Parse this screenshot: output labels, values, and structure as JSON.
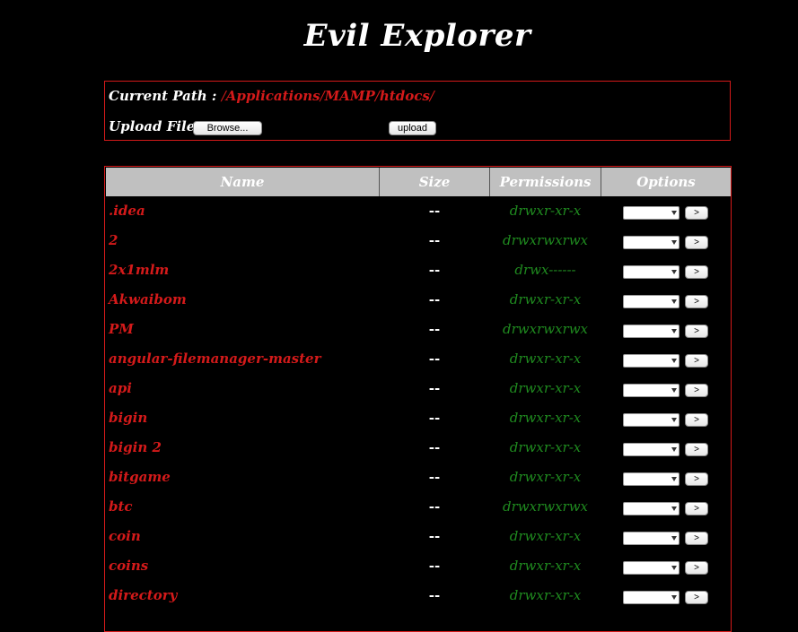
{
  "title": "Evil Explorer",
  "path": {
    "label": "Current Path :",
    "segments": [
      {
        "sep": "/",
        "name": "Applications"
      },
      {
        "sep": "/",
        "name": "MAMP"
      },
      {
        "sep": "/",
        "name": "htdocs"
      }
    ],
    "trailing_sep": "/"
  },
  "upload": {
    "label": "Upload File :",
    "browse_label": "Browse...",
    "upload_label": "upload"
  },
  "table": {
    "headers": {
      "name": "Name",
      "size": "Size",
      "permissions": "Permissions",
      "options": "Options"
    },
    "go_label": ">",
    "rows": [
      {
        "name": ".idea",
        "size": "--",
        "perm": "drwxr-xr-x"
      },
      {
        "name": "2",
        "size": "--",
        "perm": "drwxrwxrwx"
      },
      {
        "name": "2x1mlm",
        "size": "--",
        "perm": "drwx------"
      },
      {
        "name": "Akwaibom",
        "size": "--",
        "perm": "drwxr-xr-x"
      },
      {
        "name": "PM",
        "size": "--",
        "perm": "drwxrwxrwx"
      },
      {
        "name": "angular-filemanager-master",
        "size": "--",
        "perm": "drwxr-xr-x"
      },
      {
        "name": "api",
        "size": "--",
        "perm": "drwxr-xr-x"
      },
      {
        "name": "bigin",
        "size": "--",
        "perm": "drwxr-xr-x"
      },
      {
        "name": "bigin 2",
        "size": "--",
        "perm": "drwxr-xr-x"
      },
      {
        "name": "bitgame",
        "size": "--",
        "perm": "drwxr-xr-x"
      },
      {
        "name": "btc",
        "size": "--",
        "perm": "drwxrwxrwx"
      },
      {
        "name": "coin",
        "size": "--",
        "perm": "drwxr-xr-x"
      },
      {
        "name": "coins",
        "size": "--",
        "perm": "drwxr-xr-x"
      },
      {
        "name": "directory",
        "size": "--",
        "perm": "drwxr-xr-x"
      }
    ]
  },
  "colors": {
    "accent": "#d41a1a",
    "perm": "#1f8a1f",
    "header_bg": "#c0c0c0",
    "bg": "#000000"
  }
}
